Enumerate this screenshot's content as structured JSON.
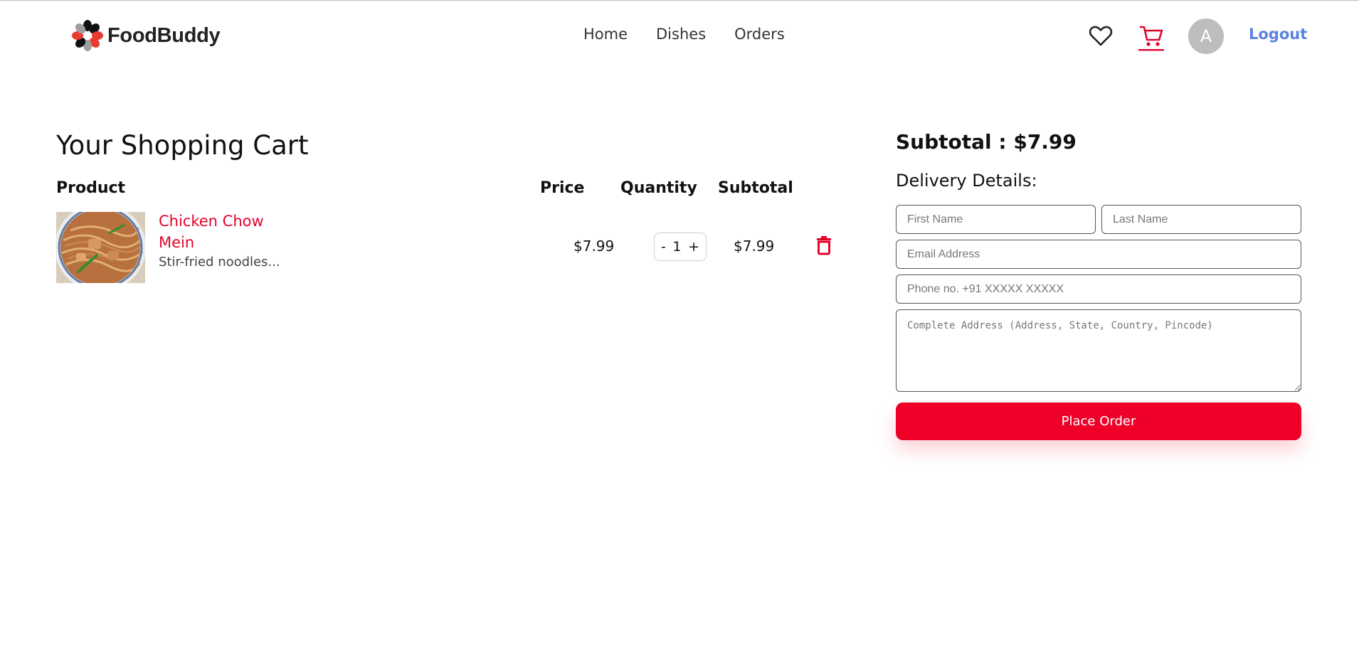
{
  "brand": {
    "name": "FoodBuddy",
    "logo_icon": "flower-logo-icon"
  },
  "nav": {
    "items": [
      "Home",
      "Dishes",
      "Orders"
    ]
  },
  "header": {
    "wishlist_icon": "heart-icon",
    "cart_icon": "cart-icon",
    "avatar_initial": "A",
    "logout_label": "Logout"
  },
  "cart": {
    "title": "Your Shopping Cart",
    "columns": {
      "product": "Product",
      "price": "Price",
      "quantity": "Quantity",
      "subtotal": "Subtotal"
    },
    "items": [
      {
        "name": "Chicken Chow Mein",
        "description": "Stir-fried noodles...",
        "price": "$7.99",
        "quantity": "1",
        "decrement": "-",
        "increment": "+",
        "subtotal": "$7.99",
        "remove_icon": "trash-icon"
      }
    ]
  },
  "summary": {
    "subtotal_label": "Subtotal : $7.99",
    "delivery_title": "Delivery Details:",
    "fields": {
      "first_name": {
        "placeholder": "First Name",
        "value": ""
      },
      "last_name": {
        "placeholder": "Last Name",
        "value": ""
      },
      "email": {
        "placeholder": "Email Address",
        "value": ""
      },
      "phone": {
        "placeholder": "Phone no. +91 XXXXX XXXXX",
        "value": ""
      },
      "address": {
        "placeholder": "Complete Address (Address, State, Country, Pincode)",
        "value": ""
      }
    },
    "place_order_label": "Place Order"
  },
  "colors": {
    "accent": "#ee0028",
    "item_name": "#e2042b",
    "logout": "#5b82e0",
    "avatar_bg": "#bdbdbd"
  }
}
